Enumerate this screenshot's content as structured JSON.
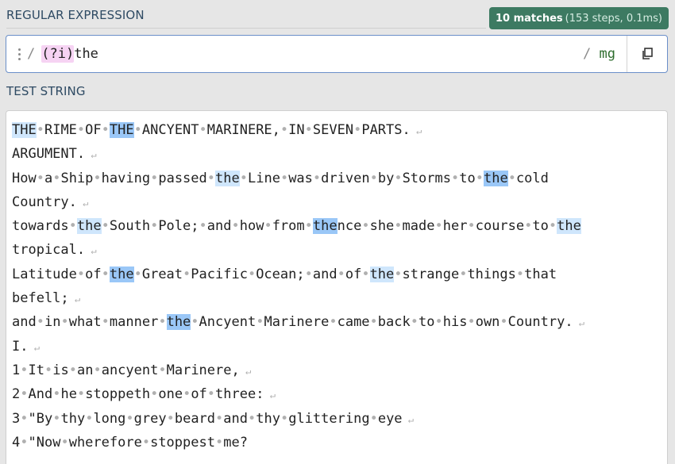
{
  "regex_section": {
    "label": "REGULAR EXPRESSION",
    "match_count": "10 matches",
    "match_detail": "(153 steps, 0.1ms)",
    "delimiter_open": "/",
    "pattern_group": "(?i)",
    "pattern_rest": "the",
    "delimiter_close": "/",
    "flags": "mg",
    "copy_icon": "copy-icon"
  },
  "test_section": {
    "label": "TEST STRING",
    "lines": [
      "{THE} RIME OF [THE] ANCYENT MARINERE, IN SEVEN PARTS.",
      "ARGUMENT.",
      "How a Ship having passed {the} Line was driven by Storms to [the] cold",
      "Country.",
      "towards {the} South Pole; and how from [the]nce she made her course to {the}",
      "tropical.",
      "Latitude of [the] Great Pacific Ocean; and of {the} strange things that",
      "befell;",
      "and in what manner [the] Ancyent Marinere came back to his own Country.",
      "I.",
      "1 It is an ancyent Marinere,",
      "2 And he stoppeth one of three:",
      "3 \"By thy long grey beard and thy glittering eye",
      "4 \"Now wherefore stoppest me?"
    ],
    "line_ends": [
      true,
      true,
      false,
      true,
      false,
      true,
      false,
      true,
      true,
      true,
      true,
      true,
      true,
      false
    ],
    "highlight_colors": {
      "alternate_a": "#cfe6fc",
      "alternate_b": "#9ac7f7"
    }
  }
}
